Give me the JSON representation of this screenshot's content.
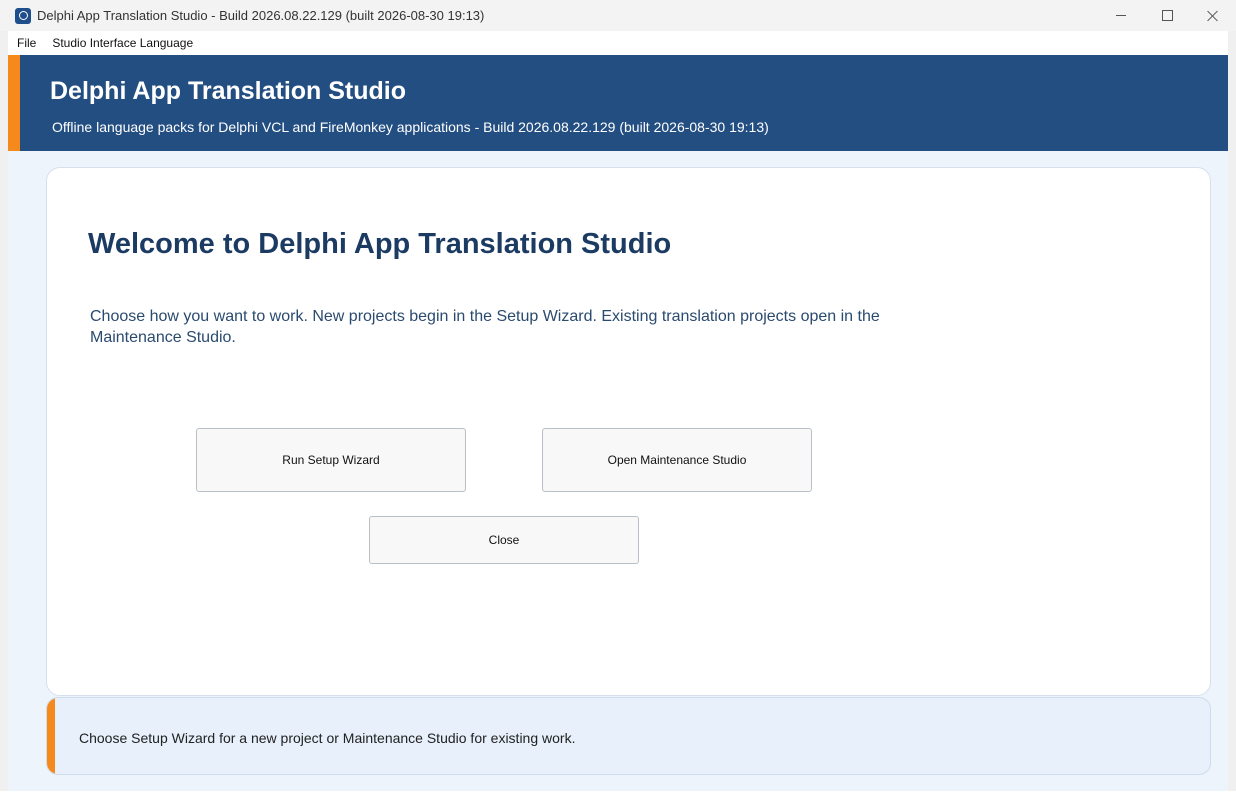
{
  "window": {
    "title": "Delphi App Translation Studio - Build 2026.08.22.129 (built 2026-08-30 19:13)",
    "icon": "app-icon",
    "controls": [
      "minimize-icon",
      "maximize-icon",
      "close-icon"
    ]
  },
  "menu": {
    "file": "File",
    "language": "Studio Interface Language"
  },
  "header": {
    "title": "Delphi App Translation Studio",
    "subtitle": "Offline language packs for Delphi VCL and FireMonkey applications - Build 2026.08.22.129 (built 2026-08-30 19:13)",
    "background_color": "#234e82",
    "accent_color": "#f5891c"
  },
  "main": {
    "title": "Welcome to Delphi App Translation Studio",
    "description": "Choose how you want to work. New projects begin in the Setup Wizard. Existing translation projects open in the Maintenance Studio.",
    "buttons": {
      "wizard": "Run Setup Wizard",
      "maintenance": "Open Maintenance Studio",
      "close": "Close"
    }
  },
  "status": {
    "text": "Choose Setup Wizard for a new project or Maintenance Studio for existing work."
  }
}
